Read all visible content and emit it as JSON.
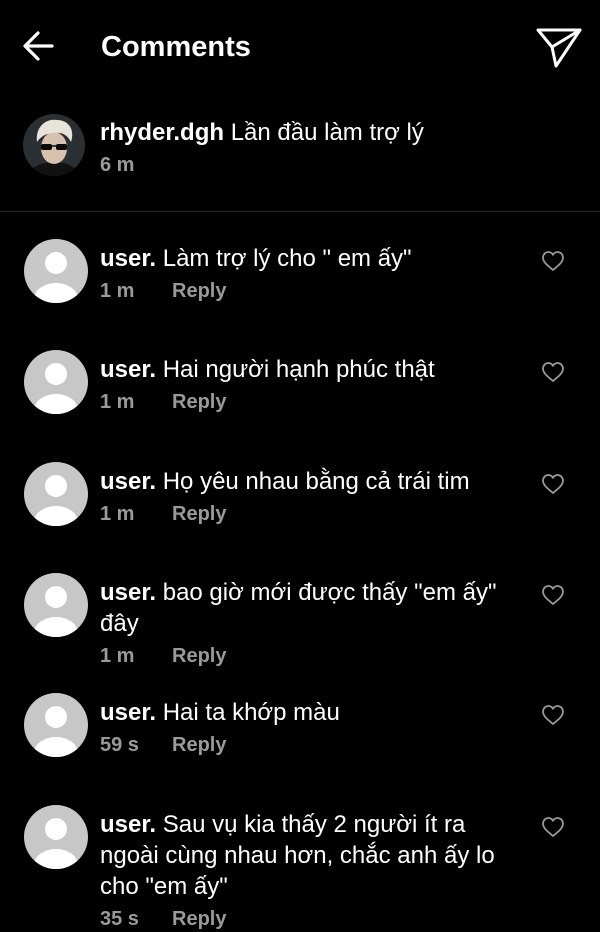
{
  "header": {
    "title": "Comments",
    "back_icon": "arrow-left-icon",
    "share_icon": "send-icon"
  },
  "caption": {
    "username": "rhyder.dgh",
    "text": "Lần đầu làm trợ lý",
    "time": "6 m"
  },
  "comments": [
    {
      "username": "user.",
      "text": "Làm trợ lý cho \" em ấy\"",
      "time": "1 m",
      "reply": "Reply"
    },
    {
      "username": "user.",
      "text": "Hai người hạnh phúc thật",
      "time": "1 m",
      "reply": "Reply"
    },
    {
      "username": "user.",
      "text": "Họ yêu nhau bằng cả trái tim",
      "time": "1 m",
      "reply": "Reply"
    },
    {
      "username": "user.",
      "text": "bao giờ mới được thấy \"em ấy\" đây",
      "time": "1 m",
      "reply": "Reply"
    },
    {
      "username": "user.",
      "text": "Hai ta khớp màu",
      "time": "59 s",
      "reply": "Reply"
    },
    {
      "username": "user.",
      "text": "Sau vụ kia thấy 2 người ít ra ngoài cùng nhau hơn, chắc anh ấy lo cho \"em ấy\"",
      "time": "35 s",
      "reply": "Reply"
    }
  ],
  "colors": {
    "background": "#000000",
    "text": "#ffffff",
    "secondary_text": "#9a9a9a",
    "avatar_placeholder": "#c7c7c7",
    "divider": "#262626"
  }
}
